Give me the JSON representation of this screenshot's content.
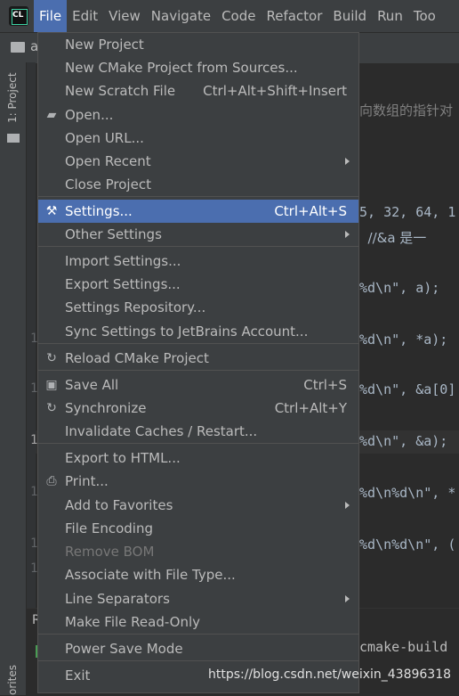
{
  "menubar": {
    "items": [
      "File",
      "Edit",
      "View",
      "Navigate",
      "Code",
      "Refactor",
      "Build",
      "Run",
      "Too"
    ],
    "active": "File",
    "logo_text": "CL"
  },
  "navbar": {
    "crumb": "a"
  },
  "left_strip": {
    "project_tab": "1: Project",
    "favorites_tab": "orites"
  },
  "editor": {
    "gutter_numbers": [
      "1",
      "1",
      "1",
      "1",
      "1",
      "1"
    ],
    "code_lines": [
      {
        "text": "向数组的指针对"
      },
      {
        "text": "5, 32, 64, 1"
      },
      {
        "text": "  //&a 是一"
      },
      {
        "text": "%d\\n\", a);"
      },
      {
        "text": "%d\\n\", *a);"
      },
      {
        "text": "%d\\n\", &a[0]"
      },
      {
        "text": "%d\\n\", &a);"
      },
      {
        "text": "%d\\n%d\\n\", *"
      },
      {
        "text": "%d\\n%d\\n\", ("
      }
    ]
  },
  "bottom_panel": {
    "label": "R",
    "cmake_text": "cmake-build"
  },
  "file_menu": {
    "items": [
      {
        "label": "New Project",
        "shortcut": "",
        "submenu": false,
        "icon": ""
      },
      {
        "label": "New CMake Project from Sources...",
        "shortcut": "",
        "submenu": false,
        "icon": ""
      },
      {
        "label": "New Scratch File",
        "shortcut": "Ctrl+Alt+Shift+Insert",
        "submenu": false,
        "icon": ""
      },
      {
        "label": "Open...",
        "shortcut": "",
        "submenu": false,
        "icon": "folder-open-icon"
      },
      {
        "label": "Open URL...",
        "shortcut": "",
        "submenu": false,
        "icon": ""
      },
      {
        "label": "Open Recent",
        "shortcut": "",
        "submenu": true,
        "icon": ""
      },
      {
        "label": "Close Project",
        "shortcut": "",
        "submenu": false,
        "icon": ""
      },
      {
        "label": "Settings...",
        "shortcut": "Ctrl+Alt+S",
        "submenu": false,
        "icon": "wrench-icon",
        "selected": true
      },
      {
        "label": "Other Settings",
        "shortcut": "",
        "submenu": true,
        "icon": ""
      },
      {
        "label": "Import Settings...",
        "shortcut": "",
        "submenu": false,
        "icon": ""
      },
      {
        "label": "Export Settings...",
        "shortcut": "",
        "submenu": false,
        "icon": ""
      },
      {
        "label": "Settings Repository...",
        "shortcut": "",
        "submenu": false,
        "icon": ""
      },
      {
        "label": "Sync Settings to JetBrains Account...",
        "shortcut": "",
        "submenu": false,
        "icon": ""
      },
      {
        "label": "Reload CMake Project",
        "shortcut": "",
        "submenu": false,
        "icon": "reload-icon"
      },
      {
        "label": "Save All",
        "shortcut": "Ctrl+S",
        "submenu": false,
        "icon": "save-icon"
      },
      {
        "label": "Synchronize",
        "shortcut": "Ctrl+Alt+Y",
        "submenu": false,
        "icon": "sync-icon"
      },
      {
        "label": "Invalidate Caches / Restart...",
        "shortcut": "",
        "submenu": false,
        "icon": ""
      },
      {
        "label": "Export to HTML...",
        "shortcut": "",
        "submenu": false,
        "icon": ""
      },
      {
        "label": "Print...",
        "shortcut": "",
        "submenu": false,
        "icon": "printer-icon"
      },
      {
        "label": "Add to Favorites",
        "shortcut": "",
        "submenu": true,
        "icon": ""
      },
      {
        "label": "File Encoding",
        "shortcut": "",
        "submenu": false,
        "icon": ""
      },
      {
        "label": "Remove BOM",
        "shortcut": "",
        "submenu": false,
        "icon": "",
        "disabled": true
      },
      {
        "label": "Associate with File Type...",
        "shortcut": "",
        "submenu": false,
        "icon": ""
      },
      {
        "label": "Line Separators",
        "shortcut": "",
        "submenu": true,
        "icon": ""
      },
      {
        "label": "Make File Read-Only",
        "shortcut": "",
        "submenu": false,
        "icon": ""
      },
      {
        "label": "Power Save Mode",
        "shortcut": "",
        "submenu": false,
        "icon": ""
      },
      {
        "label": "Exit",
        "shortcut": "",
        "submenu": false,
        "icon": ""
      }
    ]
  },
  "watermark": "https://blog.csdn.net/weixin_43896318",
  "colors": {
    "menu_bg": "#3c3f41",
    "selection": "#4b6eaf",
    "editor_bg": "#2b2b2b",
    "string": "#6a8759",
    "number": "#6897bb"
  }
}
